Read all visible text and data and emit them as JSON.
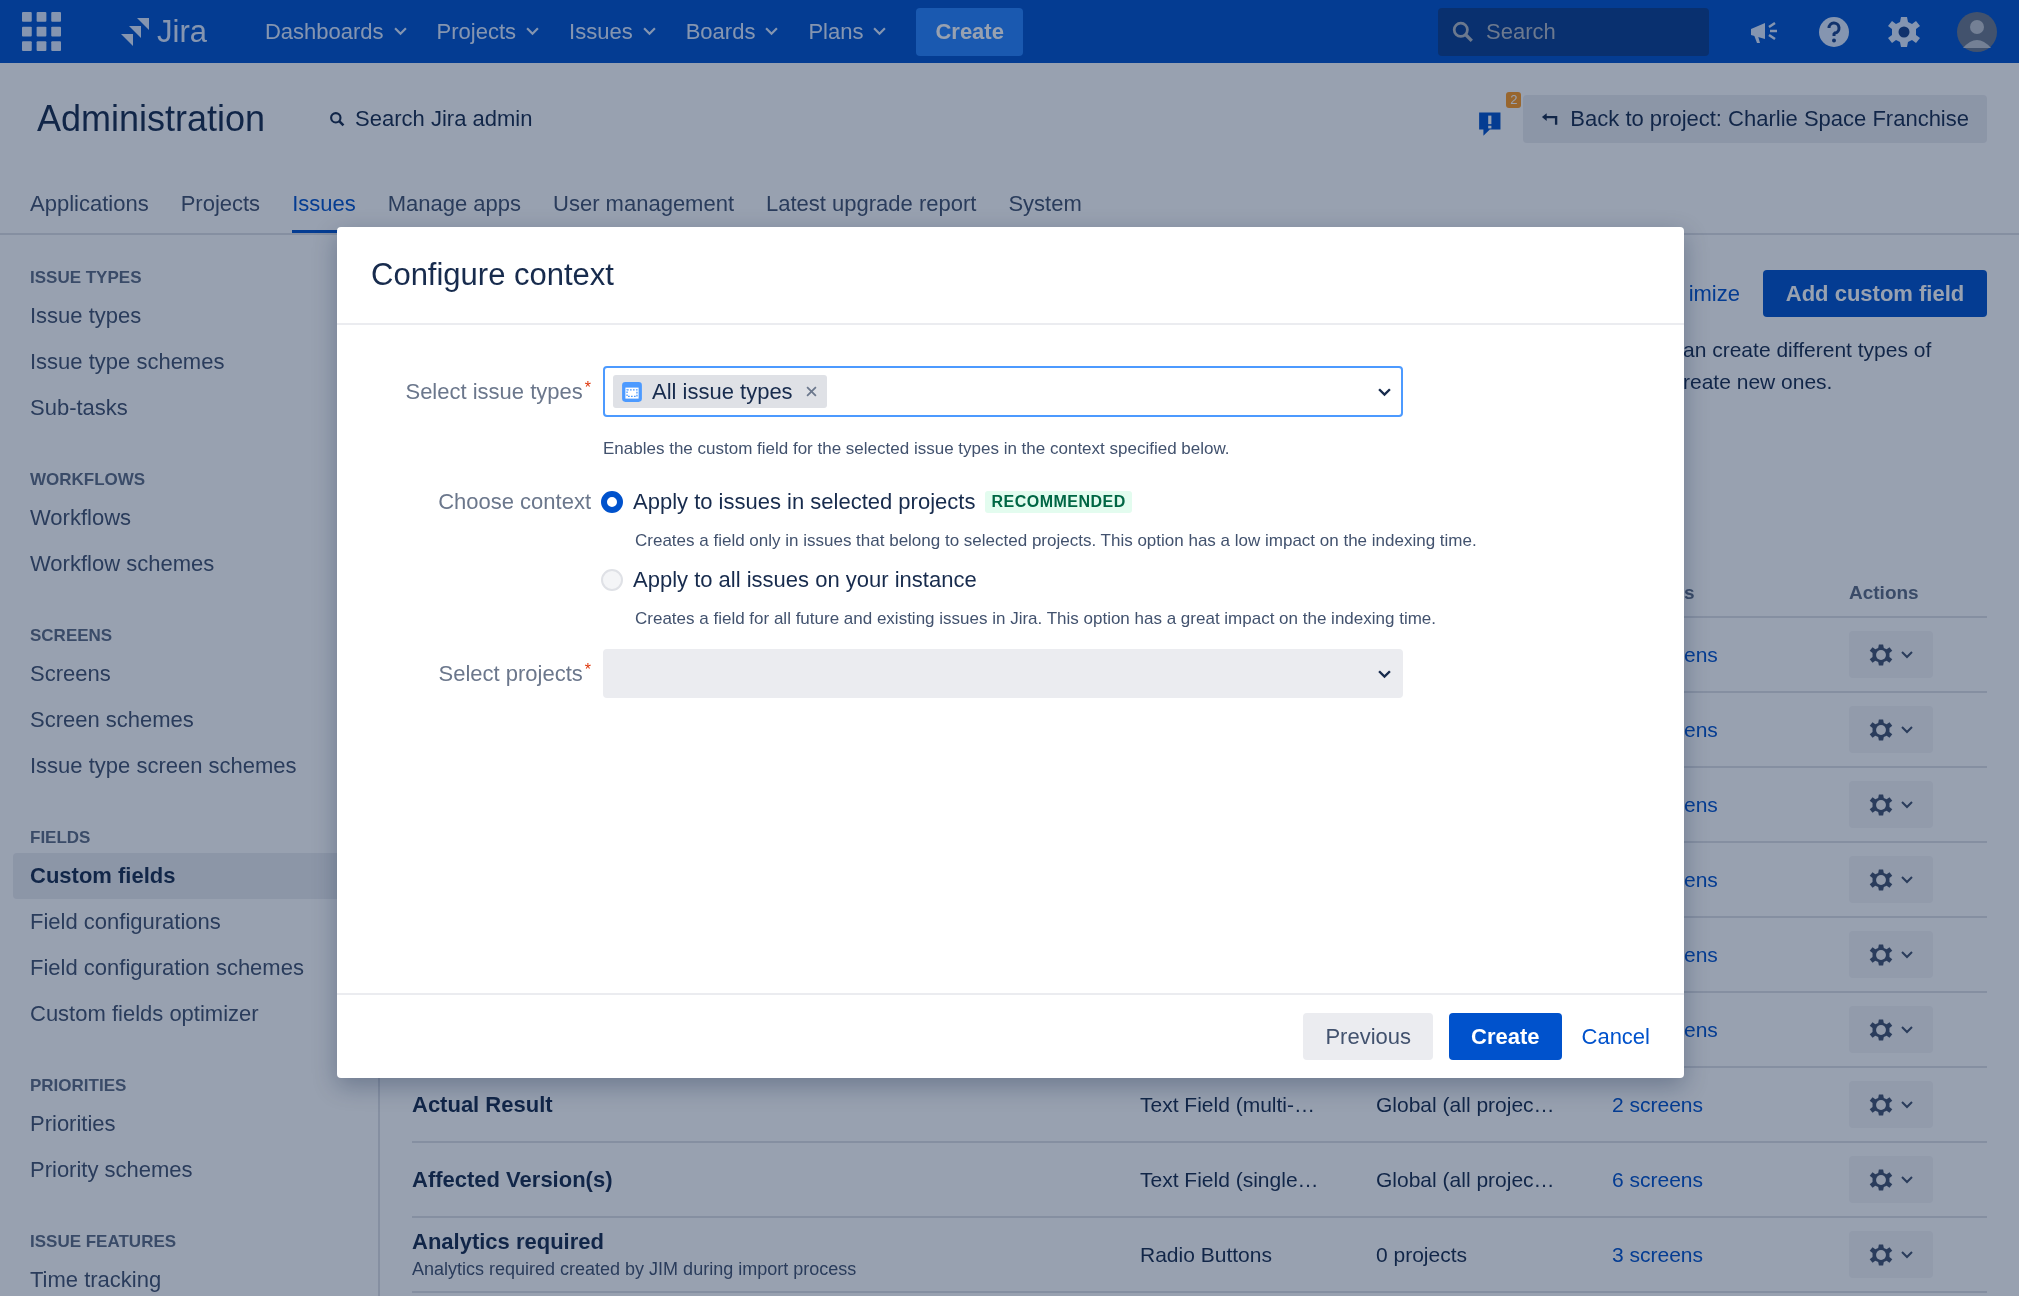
{
  "top_nav": {
    "logo": "Jira",
    "menus": [
      {
        "label": "Dashboards",
        "dropdown": true
      },
      {
        "label": "Projects",
        "dropdown": true
      },
      {
        "label": "Issues",
        "dropdown": true
      },
      {
        "label": "Boards",
        "dropdown": true
      },
      {
        "label": "Plans",
        "dropdown": true
      }
    ],
    "create_button": "Create",
    "search": {
      "placeholder": "Search"
    }
  },
  "admin_header": {
    "title": "Administration",
    "search_link": "Search Jira admin",
    "feedback_badge": "2",
    "back_button": "Back to project: Charlie Space Franchise",
    "tabs": [
      {
        "label": "Applications",
        "selected": false
      },
      {
        "label": "Projects",
        "selected": false
      },
      {
        "label": "Issues",
        "selected": true
      },
      {
        "label": "Manage apps",
        "selected": false
      },
      {
        "label": "User management",
        "selected": false
      },
      {
        "label": "Latest upgrade report",
        "selected": false
      },
      {
        "label": "System",
        "selected": false
      }
    ]
  },
  "sidebar": {
    "sections": [
      {
        "title": "ISSUE TYPES",
        "items": [
          {
            "label": "Issue types",
            "selected": false
          },
          {
            "label": "Issue type schemes",
            "selected": false
          },
          {
            "label": "Sub-tasks",
            "selected": false
          }
        ]
      },
      {
        "title": "WORKFLOWS",
        "items": [
          {
            "label": "Workflows",
            "selected": false
          },
          {
            "label": "Workflow schemes",
            "selected": false
          }
        ]
      },
      {
        "title": "SCREENS",
        "items": [
          {
            "label": "Screens",
            "selected": false
          },
          {
            "label": "Screen schemes",
            "selected": false
          },
          {
            "label": "Issue type screen schemes",
            "selected": false
          }
        ]
      },
      {
        "title": "FIELDS",
        "items": [
          {
            "label": "Custom fields",
            "selected": true
          },
          {
            "label": "Field configurations",
            "selected": false
          },
          {
            "label": "Field configuration schemes",
            "selected": false
          },
          {
            "label": "Custom fields optimizer",
            "selected": false
          }
        ]
      },
      {
        "title": "PRIORITIES",
        "items": [
          {
            "label": "Priorities",
            "selected": false
          },
          {
            "label": "Priority schemes",
            "selected": false
          }
        ]
      },
      {
        "title": "ISSUE FEATURES",
        "items": [
          {
            "label": "Time tracking",
            "selected": false
          }
        ]
      }
    ]
  },
  "main": {
    "optimizer_link": "imize",
    "add_button": "Add custom field",
    "description": [
      "an create different types of",
      "reate new ones."
    ],
    "table": {
      "columns": [
        {
          "label": "s",
          "kind": "covered"
        },
        {
          "label": "Actions",
          "kind": "actions"
        }
      ],
      "rows": [
        {
          "kind": "covered",
          "screens": "ens"
        },
        {
          "kind": "covered",
          "screens": "ens"
        },
        {
          "kind": "covered",
          "screens": "ens"
        },
        {
          "kind": "covered",
          "screens": "ens"
        },
        {
          "kind": "covered",
          "screens": "ens"
        },
        {
          "kind": "covered",
          "screens": "ens"
        },
        {
          "kind": "field",
          "name": "Actual Result",
          "type": "Text Field (multi-…",
          "context": "Global (all projec…",
          "screens": "2 screens"
        },
        {
          "kind": "field",
          "name": "Affected Version(s)",
          "type": "Text Field (single…",
          "context": "Global (all projec…",
          "screens": "6 screens"
        },
        {
          "kind": "field",
          "name": "Analytics required",
          "description": "Analytics required created by JIM during import process",
          "type": "Radio Buttons",
          "context": "0 projects",
          "screens": "3 screens"
        }
      ]
    }
  },
  "dialog": {
    "title": "Configure context",
    "issue_types": {
      "label": "Select issue types",
      "required_mark": "*",
      "tag": "All issue types",
      "help": "Enables the custom field for the selected issue types in the context specified below."
    },
    "context": {
      "label": "Choose context",
      "options": [
        {
          "label": "Apply to issues in selected projects",
          "badge": "RECOMMENDED",
          "description": "Creates a field only in issues that belong to selected projects. This option has a low impact on the indexing time.",
          "selected": true
        },
        {
          "label": "Apply to all issues on your instance",
          "description": "Creates a field for all future and existing issues in Jira. This option has a great impact on the indexing time.",
          "selected": false
        }
      ]
    },
    "projects": {
      "label": "Select projects",
      "required_mark": "*",
      "disabled": true
    },
    "buttons": [
      {
        "label": "Previous",
        "kind": "default"
      },
      {
        "label": "Create",
        "kind": "primary"
      },
      {
        "label": "Cancel",
        "kind": "link"
      }
    ]
  }
}
